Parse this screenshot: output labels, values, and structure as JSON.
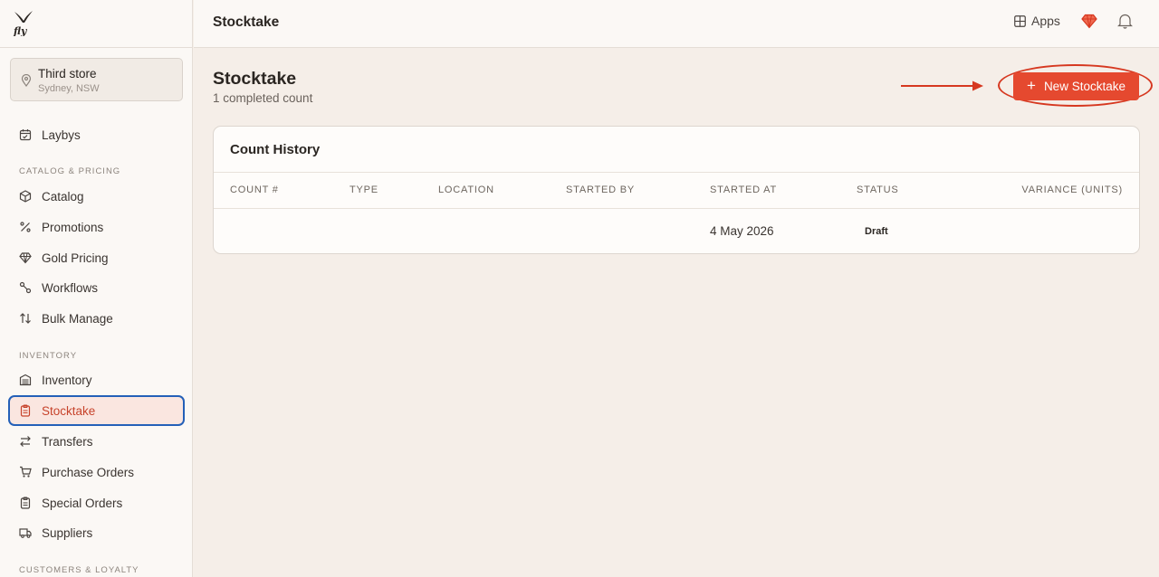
{
  "app": {
    "logo_text": "fly"
  },
  "store": {
    "name": "Third store",
    "location": "Sydney, NSW"
  },
  "sidebar": {
    "items": [
      {
        "label": "Laybys",
        "icon": "calendar-check-icon"
      },
      {
        "label": "Catalog",
        "icon": "box-icon"
      },
      {
        "label": "Promotions",
        "icon": "percent-icon"
      },
      {
        "label": "Gold Pricing",
        "icon": "gem-icon"
      },
      {
        "label": "Workflows",
        "icon": "workflow-icon"
      },
      {
        "label": "Bulk Manage",
        "icon": "arrows-up-down-icon"
      },
      {
        "label": "Inventory",
        "icon": "warehouse-icon"
      },
      {
        "label": "Stocktake",
        "icon": "clipboard-icon",
        "active": true
      },
      {
        "label": "Transfers",
        "icon": "arrows-left-right-icon"
      },
      {
        "label": "Purchase Orders",
        "icon": "cart-icon"
      },
      {
        "label": "Special Orders",
        "icon": "clipboard-list-icon"
      },
      {
        "label": "Suppliers",
        "icon": "truck-icon"
      }
    ],
    "sections": [
      "CATALOG & PRICING",
      "INVENTORY",
      "CUSTOMERS & LOYALTY"
    ]
  },
  "topbar": {
    "title": "Stocktake",
    "apps_label": "Apps"
  },
  "page": {
    "title": "Stocktake",
    "subtitle": "1 completed count",
    "new_button_label": "New Stocktake"
  },
  "history": {
    "title": "Count History",
    "columns": [
      "COUNT #",
      "TYPE",
      "LOCATION",
      "STARTED BY",
      "STARTED AT",
      "STATUS",
      "VARIANCE (UNITS)"
    ],
    "rows": [
      {
        "count": "",
        "type": "",
        "location": "",
        "started_by": "",
        "started_at": "4 May 2026",
        "status": "Draft",
        "variance": ""
      }
    ]
  },
  "colors": {
    "accent": "#e5492f",
    "active_bg": "#fae6e0",
    "focus_ring": "#2460b8",
    "background": "#f5eee8"
  }
}
